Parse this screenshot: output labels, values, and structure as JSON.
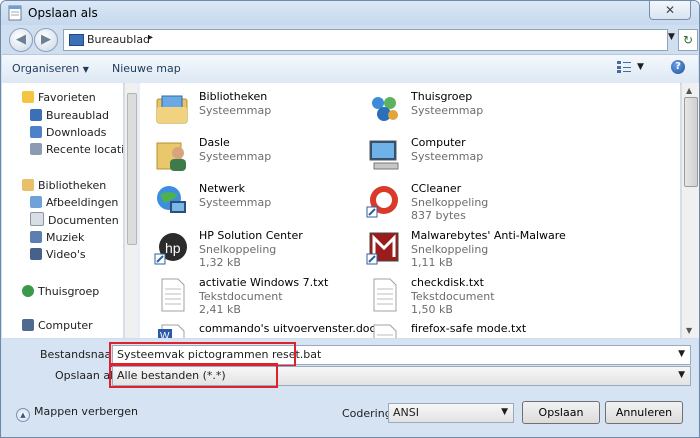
{
  "window": {
    "title": "Opslaan als",
    "close_label": "✕"
  },
  "address": {
    "location": "Bureaublad"
  },
  "toolbar": {
    "organize": "Organiseren",
    "new_folder": "Nieuwe map",
    "help": "?"
  },
  "sidebar": {
    "favorites": "Favorieten",
    "fav_items": [
      "Bureaublad",
      "Downloads",
      "Recente locaties"
    ],
    "libraries": "Bibliotheken",
    "lib_items": [
      "Afbeeldingen",
      "Documenten",
      "Muziek",
      "Video's"
    ],
    "homegroup": "Thuisgroep",
    "computer": "Computer"
  },
  "files": [
    {
      "name": "Bibliotheken",
      "meta": "Systeemmap",
      "meta2": ""
    },
    {
      "name": "Thuisgroep",
      "meta": "Systeemmap",
      "meta2": ""
    },
    {
      "name": "Dasle",
      "meta": "Systeemmap",
      "meta2": ""
    },
    {
      "name": "Computer",
      "meta": "Systeemmap",
      "meta2": ""
    },
    {
      "name": "Netwerk",
      "meta": "Systeemmap",
      "meta2": ""
    },
    {
      "name": "CCleaner",
      "meta": "Snelkoppeling",
      "meta2": "837 bytes"
    },
    {
      "name": "HP Solution Center",
      "meta": "Snelkoppeling",
      "meta2": "1,32 kB"
    },
    {
      "name": "Malwarebytes' Anti-Malware",
      "meta": "Snelkoppeling",
      "meta2": "1,11 kB"
    },
    {
      "name": "activatie Windows 7.txt",
      "meta": "Tekstdocument",
      "meta2": "2,41 kB"
    },
    {
      "name": "checkdisk.txt",
      "meta": "Tekstdocument",
      "meta2": "1,50 kB"
    },
    {
      "name": "commando's uitvoervenster.docx - ",
      "meta": "",
      "meta2": ""
    },
    {
      "name": "firefox-safe mode.txt",
      "meta": "",
      "meta2": ""
    }
  ],
  "form": {
    "filename_label": "Bestandsnaam:",
    "filename_value": "Systeemvak pictogrammen reset.bat",
    "saveas_label": "Opslaan als:",
    "saveas_value": "Alle bestanden  (*.*)",
    "encoding_label": "Codering:",
    "encoding_value": "ANSI",
    "hide_folders": "Mappen verbergen",
    "save_button": "Opslaan",
    "cancel_button": "Annuleren"
  },
  "colors": {
    "highlight": "#e0202a",
    "accent": "#1f4f9e"
  }
}
